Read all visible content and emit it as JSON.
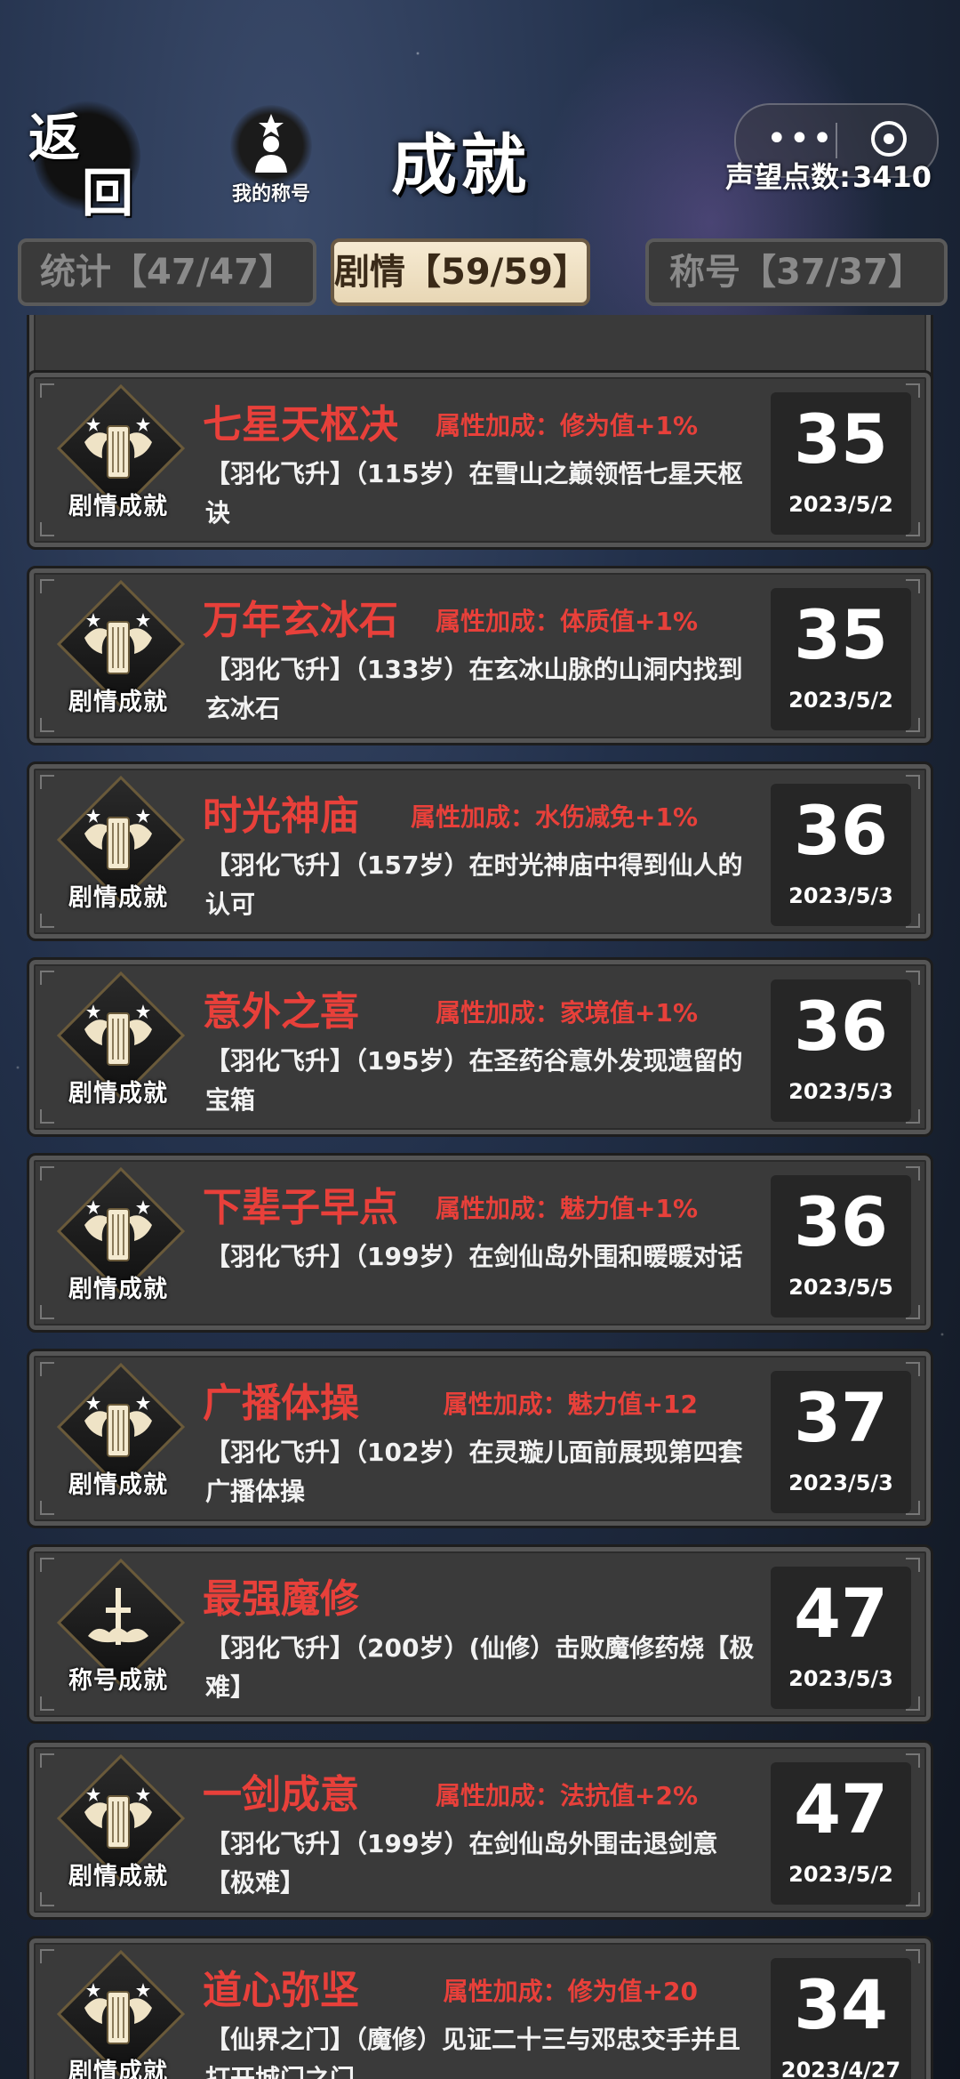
{
  "header": {
    "back_top": "返",
    "back_bottom": "回",
    "my_title_label": "我的称号",
    "page_title": "成就",
    "more_icon": "more-dots-icon",
    "target_icon": "target-icon",
    "prestige_label": "声望点数:",
    "prestige_value": "3410"
  },
  "tabs": [
    {
      "label": "统计【47/47】",
      "active": false
    },
    {
      "label": "剧情【59/59】",
      "active": true
    },
    {
      "label": "称号【37/37】",
      "active": false
    }
  ],
  "achievements": [
    {
      "badge": "剧情成就",
      "name": "七星天枢决",
      "bonus": "属性加成：修为值+1%",
      "desc": "【羽化飞升】（115岁）在雪山之巅领悟七星天枢诀",
      "points": "35",
      "date": "2023/5/2"
    },
    {
      "badge": "剧情成就",
      "name": "万年玄冰石",
      "bonus": "属性加成：体质值+1%",
      "desc": "【羽化飞升】（133岁）在玄冰山脉的山洞内找到玄冰石",
      "points": "35",
      "date": "2023/5/2"
    },
    {
      "badge": "剧情成就",
      "name": "时光神庙",
      "bonus": "属性加成：水伤减免+1%",
      "desc": "【羽化飞升】（157岁）在时光神庙中得到仙人的认可",
      "points": "36",
      "date": "2023/5/3"
    },
    {
      "badge": "剧情成就",
      "name": "意外之喜",
      "bonus": "属性加成：家境值+1%",
      "desc": "【羽化飞升】（195岁）在圣药谷意外发现遗留的宝箱",
      "points": "36",
      "date": "2023/5/3"
    },
    {
      "badge": "剧情成就",
      "name": "下辈子早点",
      "bonus": "属性加成：魅力值+1%",
      "desc": "【羽化飞升】（199岁）在剑仙岛外围和暖暖对话",
      "points": "36",
      "date": "2023/5/5"
    },
    {
      "badge": "剧情成就",
      "name": "广播体操",
      "bonus": "属性加成：魅力值+12",
      "desc": "【羽化飞升】（102岁）在灵璇儿面前展现第四套广播体操",
      "points": "37",
      "date": "2023/5/3"
    },
    {
      "badge": "称号成就",
      "name": "最强魔修",
      "bonus": "",
      "desc": "【羽化飞升】（200岁）(仙修）击败魔修药烧【极难】",
      "points": "47",
      "date": "2023/5/3"
    },
    {
      "badge": "剧情成就",
      "name": "一剑成意",
      "bonus": "属性加成：法抗值+2%",
      "desc": "【羽化飞升】（199岁）在剑仙岛外围击退剑意【极难】",
      "points": "47",
      "date": "2023/5/2"
    },
    {
      "badge": "剧情成就",
      "name": "道心弥坚",
      "bonus": "属性加成：修为值+20",
      "desc": "【仙界之门】（魔修）见证二十三与邓忠交手并且打开城门之门",
      "points": "34",
      "date": "2023/4/27"
    }
  ]
}
